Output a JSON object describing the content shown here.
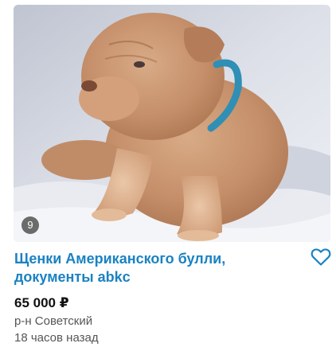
{
  "listing": {
    "photo_count": "9",
    "title": "Щенки Американского булли, документы abkc",
    "price": "65 000 ₽",
    "location": "р-н Советский",
    "posted": "18 часов назад"
  },
  "icons": {
    "favorite": "heart-outline-icon"
  },
  "colors": {
    "title": "#1a82c2",
    "favorite": "#1a82c2",
    "text_secondary": "#555555",
    "price": "#111111"
  }
}
